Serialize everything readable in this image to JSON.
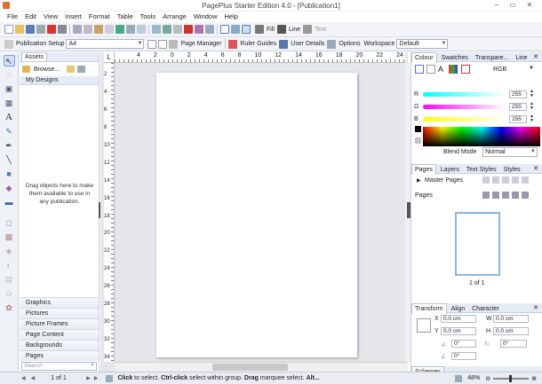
{
  "window": {
    "title": "PagePlus Starter Edition 4.0 - [Publication1]"
  },
  "menu": [
    "File",
    "Edit",
    "View",
    "Insert",
    "Format",
    "Table",
    "Tools",
    "Arrange",
    "Window",
    "Help"
  ],
  "toolbar1": {
    "fill_label": "Fill",
    "line_label": "Line",
    "text_label": "Text"
  },
  "toolbar2": {
    "publication_setup": "Publication Setup",
    "page_size": "A4",
    "page_manager": "Page Manager",
    "ruler_guides": "Ruler Guides",
    "user_details": "User Details",
    "options": "Options",
    "workspace_label": "Workspace",
    "workspace_value": "Default"
  },
  "assets": {
    "tab": "Assets",
    "browse": "Browse...",
    "my_designs": "My Designs",
    "drop_hint": "Drag objects here to make them available to use in any publication.",
    "categories": [
      "Graphics",
      "Pictures",
      "Picture Frames",
      "Page Content",
      "Backgrounds",
      "Pages"
    ],
    "search_placeholder": "Search"
  },
  "ruler": {
    "top": [
      "4",
      "2",
      "0",
      "2",
      "4",
      "6",
      "8",
      "10",
      "12",
      "14",
      "16",
      "18",
      "20",
      "22",
      "24"
    ],
    "left": [
      "2",
      "4",
      "6",
      "8",
      "10",
      "12",
      "14",
      "16",
      "18",
      "20",
      "22",
      "24",
      "26",
      "28",
      "30",
      "32",
      "34"
    ]
  },
  "colour": {
    "tabs": [
      "Colour",
      "Swatches",
      "Transpare...",
      "Line"
    ],
    "model": "RGB",
    "channels": [
      {
        "label": "R",
        "value": "255"
      },
      {
        "label": "G",
        "value": "255"
      },
      {
        "label": "B",
        "value": "255"
      }
    ],
    "blend_label": "Blend Mode",
    "blend_value": "Normal"
  },
  "pages": {
    "tabs": [
      "Pages",
      "Layers",
      "Text Styles",
      "Styles"
    ],
    "master_pages": "Master Pages",
    "pages_label": "Pages",
    "thumb_label": "1 of 1"
  },
  "transform": {
    "tabs": [
      "Transform",
      "Align",
      "Character"
    ],
    "fields": [
      {
        "label": "X",
        "value": "0.0 cm"
      },
      {
        "label": "W",
        "value": "0.0 cm"
      },
      {
        "label": "Y",
        "value": "0.0 cm"
      },
      {
        "label": "H",
        "value": "0.0 cm"
      }
    ],
    "rotate": "0°",
    "shear": "0°",
    "angle": "0°"
  },
  "schemes": {
    "label": "Schemes"
  },
  "status": {
    "page": "1 of 1",
    "click": "Click",
    "t1": " to select. ",
    "ctrl": "Ctrl-click",
    "t2": " select within group. ",
    "drag": "Drag",
    "t3": " marquee select. ",
    "alt": "Alt...",
    "zoom": "48%"
  },
  "colors": {
    "accent": "#1e6fd9",
    "panel": "#e4ebf5"
  }
}
